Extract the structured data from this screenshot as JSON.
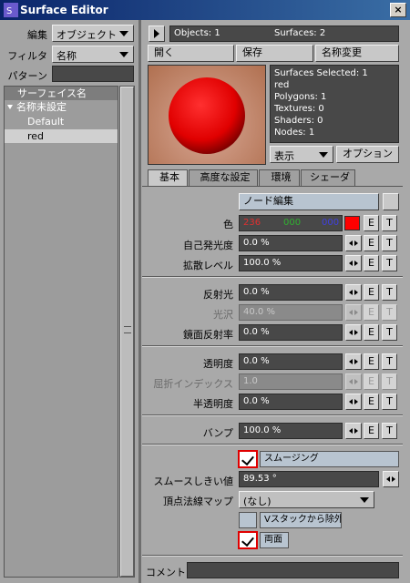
{
  "window": {
    "title": "Surface Editor",
    "close": "×"
  },
  "left": {
    "edit_label": "編集",
    "edit_value": "オブジェクト",
    "filter_label": "フィルタ",
    "filter_value": "名称",
    "pattern_label": "パターン",
    "pattern_value": "",
    "list_header": "サーフェイス名",
    "tree": [
      {
        "label": "名称未設定"
      },
      {
        "label": "Default"
      },
      {
        "label": "red"
      }
    ]
  },
  "top": {
    "objects": "Objects: 1",
    "surfaces": "Surfaces: 2",
    "open": "開く",
    "save": "保存",
    "rename": "名称変更"
  },
  "info": {
    "surfaces_selected": "Surfaces Selected: 1",
    "name": "red",
    "polygons": "Polygons: 1",
    "textures": "Textures: 0",
    "shaders": "Shaders: 0",
    "nodes": "Nodes: 1"
  },
  "preview": {
    "display": "表示",
    "options": "オプション",
    "sphere_color": "#ff0000"
  },
  "tabs": [
    "基本",
    "高度な設定",
    "環境",
    "シェーダ"
  ],
  "node_edit": "ノード編集",
  "color": {
    "label": "色",
    "r": "236",
    "g": "000",
    "b": "000",
    "swatch": "#ff0000"
  },
  "params": {
    "luminosity": {
      "label": "自己発光度",
      "value": "0.0 %"
    },
    "diffuse": {
      "label": "拡散レベル",
      "value": "100.0 %"
    },
    "specularity": {
      "label": "反射光",
      "value": "0.0 %"
    },
    "gloss": {
      "label": "光沢",
      "value": "40.0 %"
    },
    "reflection": {
      "label": "鏡面反射率",
      "value": "0.0 %"
    },
    "transparency": {
      "label": "透明度",
      "value": "0.0 %"
    },
    "refraction": {
      "label": "屈折インデックス",
      "value": "1.0"
    },
    "translucency": {
      "label": "半透明度",
      "value": "0.0 %"
    },
    "bump": {
      "label": "バンプ",
      "value": "100.0 %"
    }
  },
  "smoothing": {
    "label": "スムージング",
    "checked": true,
    "threshold_label": "スムースしきい値",
    "threshold_value": "89.53 °",
    "vertex_normal_label": "頂点法線マップ",
    "vertex_normal_value": "(なし)",
    "exclude_vstack": "Vスタックから除外",
    "double_sided": "両面",
    "double_sided_checked": true
  },
  "comment": {
    "label": "コメント",
    "value": ""
  },
  "et_labels": {
    "e": "E",
    "t": "T"
  }
}
